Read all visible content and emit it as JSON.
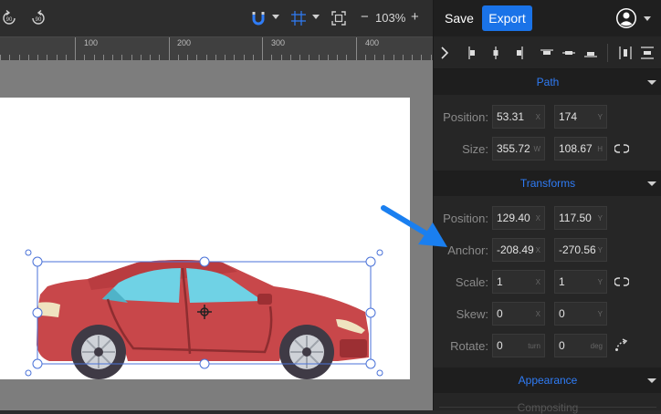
{
  "toolbar": {
    "undo_icon": "undo-90-icon",
    "redo_icon": "redo-90-icon",
    "undo_label": "90",
    "redo_label": "90",
    "snap_icon": "magnet-icon",
    "grid_icon": "grid-icon",
    "fit_icon": "fit-to-screen-icon",
    "zoom_minus": "−",
    "zoom_value": "103%",
    "zoom_plus": "+"
  },
  "ruler": {
    "labels": [
      "100",
      "200",
      "300",
      "400"
    ]
  },
  "header": {
    "save_label": "Save",
    "export_label": "Export",
    "avatar_icon": "user-avatar-icon"
  },
  "path": {
    "title": "Path",
    "position_label": "Position:",
    "position_x": "53.31",
    "position_y": "174",
    "size_label": "Size:",
    "size_w": "355.72",
    "size_h": "108.67",
    "unit_x": "X",
    "unit_y": "Y",
    "unit_w": "W",
    "unit_h": "H"
  },
  "transforms": {
    "title": "Transforms",
    "position_label": "Position:",
    "position_x": "129.40",
    "position_y": "117.50",
    "anchor_label": "Anchor:",
    "anchor_x": "-208.49",
    "anchor_y": "-270.56",
    "scale_label": "Scale:",
    "scale_x": "1",
    "scale_y": "1",
    "skew_label": "Skew:",
    "skew_x": "0",
    "skew_y": "0",
    "rotate_label": "Rotate:",
    "rotate_turn": "0",
    "rotate_deg": "0",
    "unit_turn": "turn",
    "unit_deg": "deg",
    "unit_x": "X",
    "unit_y": "Y"
  },
  "appearance": {
    "title": "Appearance",
    "compositing": "Compositing"
  },
  "colors": {
    "accent": "#1a73e8",
    "section_title": "#2f7cf6",
    "car_body": "#c8474a",
    "car_window": "#6fd2e5",
    "selection": "#4a72d8",
    "annotation_arrow": "#1a7ff0"
  }
}
